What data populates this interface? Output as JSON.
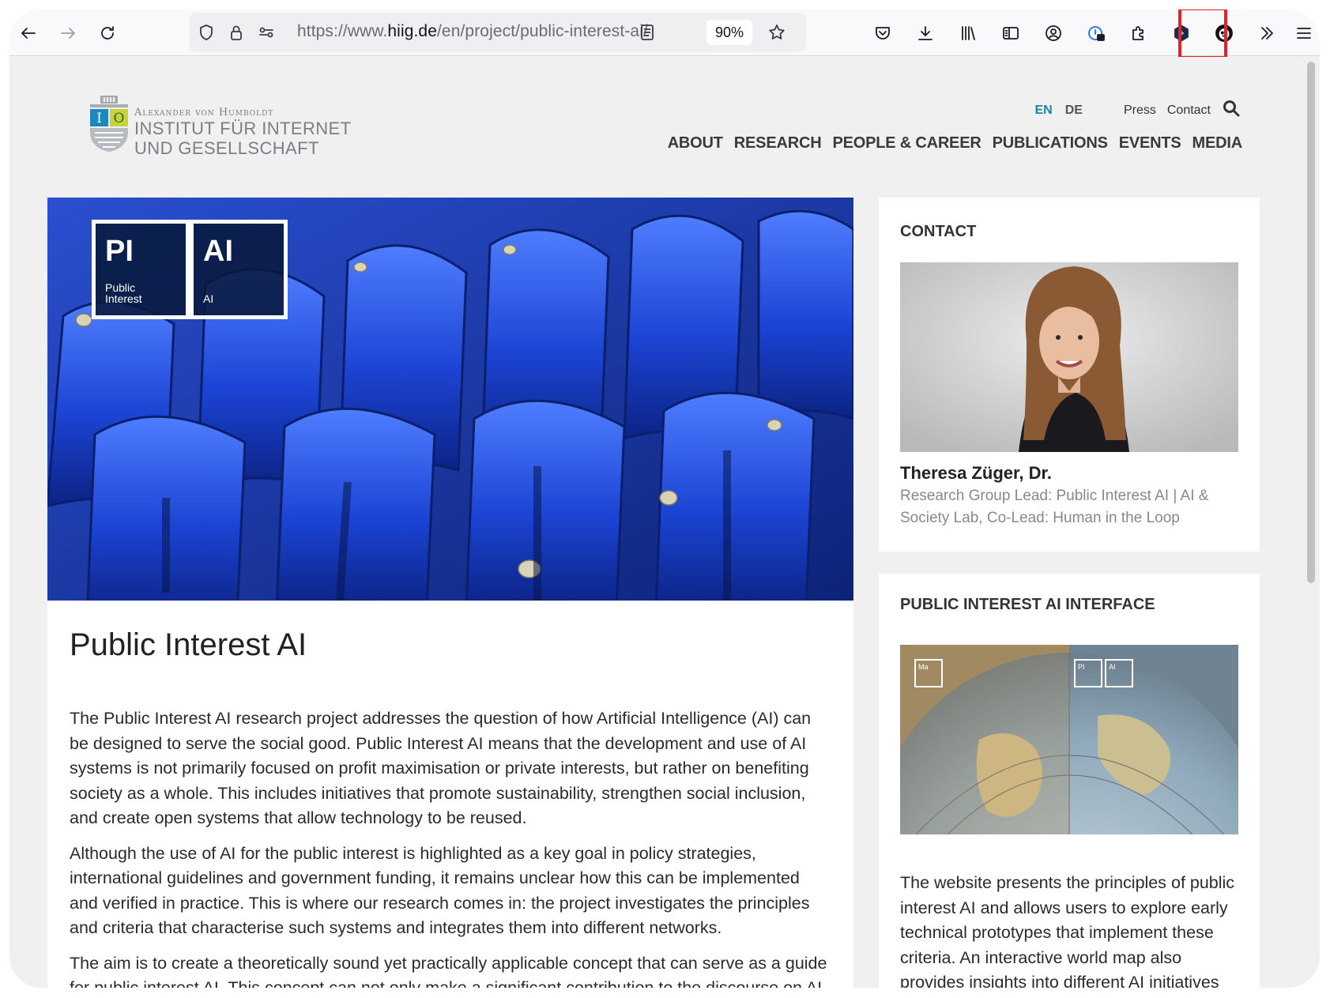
{
  "browser": {
    "url_prefix": "https://www.",
    "url_host": "hiig.de",
    "url_path": "/en/project/public-interest-ai/",
    "zoom": "90%"
  },
  "icons": {
    "back": "arrow-left-icon",
    "forward": "arrow-right-icon",
    "reload": "reload-icon",
    "shield": "shield-icon",
    "lock": "lock-icon",
    "permissions": "permissions-icon",
    "reader": "reader-view-icon",
    "bookmark": "star-icon",
    "pocket": "pocket-icon",
    "downloads": "download-icon",
    "library": "library-icon",
    "sidebar": "sidebar-icon",
    "account": "account-icon",
    "password": "password-manager-icon",
    "extensions": "puzzle-icon",
    "extension_hex": "hexagon-extension-icon",
    "extension_lion": "lion-extension-icon",
    "overflow": "chevrons-right-icon",
    "menu": "hamburger-menu-icon",
    "search": "search-icon"
  },
  "site": {
    "logo": {
      "line1": "Alexander von Humboldt",
      "line2": "INSTITUT FÜR INTERNET",
      "line3": "UND GESELLSCHAFT"
    },
    "top_nav": {
      "lang_en": "EN",
      "lang_de": "DE",
      "press": "Press",
      "contact": "Contact"
    },
    "main_nav": [
      "ABOUT",
      "RESEARCH",
      "PEOPLE & CAREER",
      "PUBLICATIONS",
      "EVENTS",
      "MEDIA"
    ]
  },
  "hero": {
    "tag1_big": "PI",
    "tag1_small_1": "Public",
    "tag1_small_2": "Interest",
    "tag2_big": "AI",
    "tag2_small": "AI"
  },
  "article": {
    "title": "Public Interest AI",
    "paragraphs": [
      "The Public Interest AI research project addresses the question of how Artificial Intelligence (AI) can be designed to serve the social good. Public Interest AI means that the development and use of AI systems is not primarily focused on profit maximisation or private interests, but rather on benefiting society as a whole. This includes initiatives that promote sustainability, strengthen social inclusion, and create open systems that allow technology to be reused.",
      "Although the use of AI for the public interest is highlighted as a key goal in policy strategies, international guidelines and government funding, it remains unclear how this can be implemented and verified in practice. This is where our  research comes in: the project investigates the principles and criteria that characterise such systems and integrates them into different networks.",
      "The aim is to create a theoretically sound yet practically applicable concept that can serve as a guide for public interest AI. This concept can not only make a significant contribution to the discourse on AI"
    ]
  },
  "sidebar": {
    "contact_heading": "CONTACT",
    "person_name": "Theresa Züger, Dr.",
    "person_role": "Research Group Lead: Public Interest AI | AI & Society Lab, Co-Lead: Human in the Loop",
    "interface_heading": "PUBLIC INTEREST AI INTERFACE",
    "globe_tag1": "Ma",
    "globe_tag2": "PI",
    "globe_tag3": "AI",
    "interface_text": "The website presents the principles of public interest AI and allows users to explore early technical prototypes that implement these criteria. An interactive world map also provides insights into different AI initiatives"
  },
  "colors": {
    "accent_lang": "#1e7fa8",
    "highlight_box": "#e8202a",
    "hero_blue": "#1d3ea8"
  }
}
